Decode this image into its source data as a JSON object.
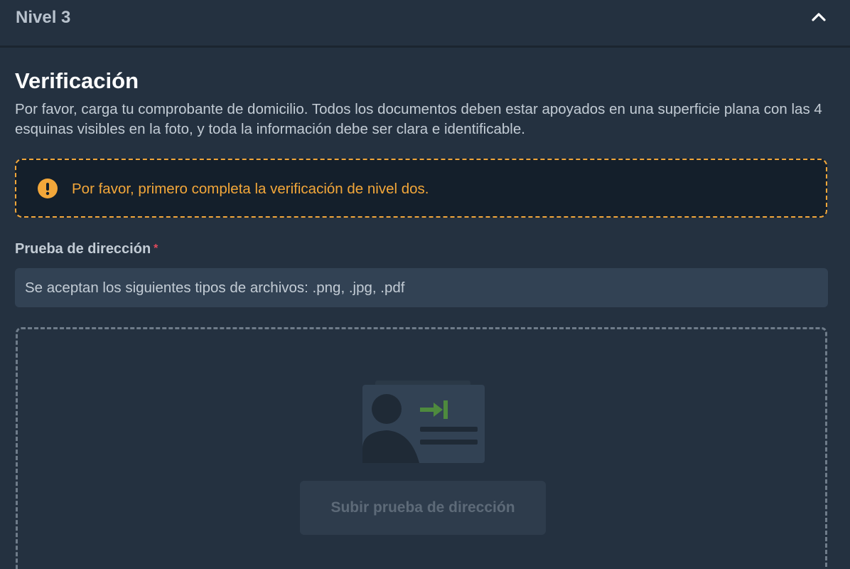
{
  "section": {
    "title": "Nivel 3",
    "toggle_icon": "chevron-up-icon"
  },
  "verification": {
    "heading": "Verificación",
    "description": "Por favor, carga tu comprobante de domicilio. Todos los documentos deben estar apoyados en una superficie plana con las 4 esquinas visibles en la foto, y toda la información debe ser clara e identificable."
  },
  "alert": {
    "icon": "exclamation-circle-icon",
    "message": "Por favor, primero completa la verificación de nivel dos.",
    "color": "#f3a73a"
  },
  "address_proof": {
    "label": "Prueba de dirección",
    "required_mark": "*",
    "file_types_hint": "Se aceptan los siguientes tipos de archivos: .png, .jpg, .pdf",
    "illustration_icon": "id-card-upload-icon",
    "upload_button_label": "Subir prueba de dirección"
  },
  "colors": {
    "background": "#243140",
    "accent_warning": "#f3a73a",
    "required": "#e04a5c",
    "illustration_arrow": "#4e8a3e"
  }
}
